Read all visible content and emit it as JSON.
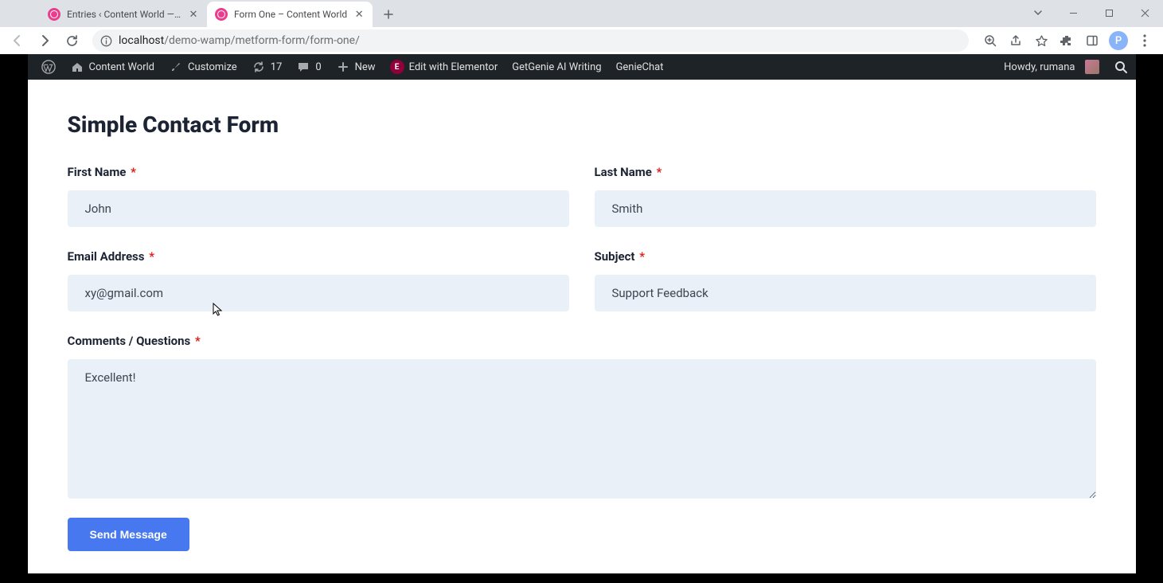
{
  "browser": {
    "tabs": [
      {
        "title": "Entries ‹ Content World — WordPress",
        "active": false
      },
      {
        "title": "Form One – Content World",
        "active": true
      }
    ],
    "url_host": "localhost",
    "url_path": "/demo-wamp/metform-form/form-one/",
    "profile_initial": "P"
  },
  "adminbar": {
    "site_name": "Content World",
    "customize": "Customize",
    "updates": "17",
    "comments": "0",
    "new": "New",
    "elementor": "Edit with Elementor",
    "genie_writing": "GetGenie AI Writing",
    "genie_chat": "GenieChat",
    "howdy": "Howdy, rumana"
  },
  "page": {
    "title": "Simple Contact Form",
    "fields": {
      "first_name": {
        "label": "First Name",
        "value": "John"
      },
      "last_name": {
        "label": "Last Name",
        "value": "Smith"
      },
      "email": {
        "label": "Email Address",
        "value": "xy@gmail.com"
      },
      "subject": {
        "label": "Subject",
        "value": "Support Feedback"
      },
      "comments": {
        "label": "Comments / Questions",
        "value": "Excellent!"
      }
    },
    "submit_label": "Send Message",
    "required_mark": "*"
  }
}
